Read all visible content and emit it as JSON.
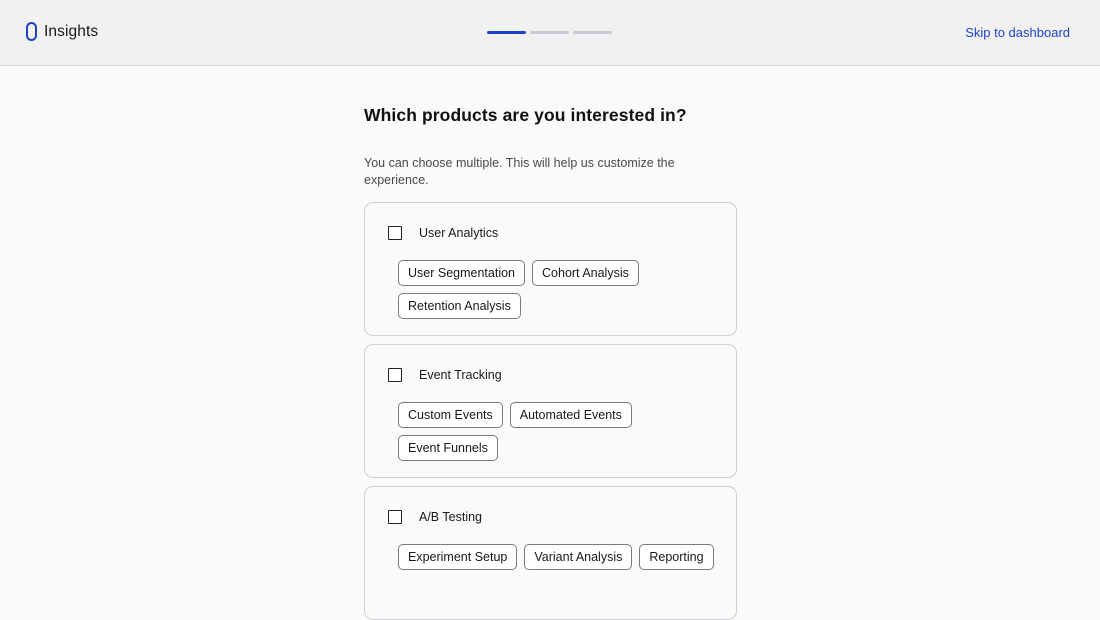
{
  "header": {
    "logo_text": "Insights",
    "progress": {
      "total_steps": 3,
      "current_step": 1
    },
    "skip_label": "Skip to dashboard"
  },
  "main": {
    "title": "Which products are you interested in?",
    "subtitle": "You can choose multiple. This will help us customize the experience.",
    "products": [
      {
        "name": "User Analytics",
        "checked": false,
        "tags": [
          "User Segmentation",
          "Cohort Analysis",
          "Retention Analysis"
        ]
      },
      {
        "name": "Event Tracking",
        "checked": false,
        "tags": [
          "Custom Events",
          "Automated Events",
          "Event Funnels"
        ]
      },
      {
        "name": "A/B Testing",
        "checked": false,
        "tags": [
          "Experiment Setup",
          "Variant Analysis",
          "Reporting"
        ]
      }
    ]
  },
  "colors": {
    "accent": "#1d44c8",
    "progress_inactive": "#c9c9d6",
    "header_bg": "#f1f1f2",
    "page_bg": "#fafafa"
  }
}
